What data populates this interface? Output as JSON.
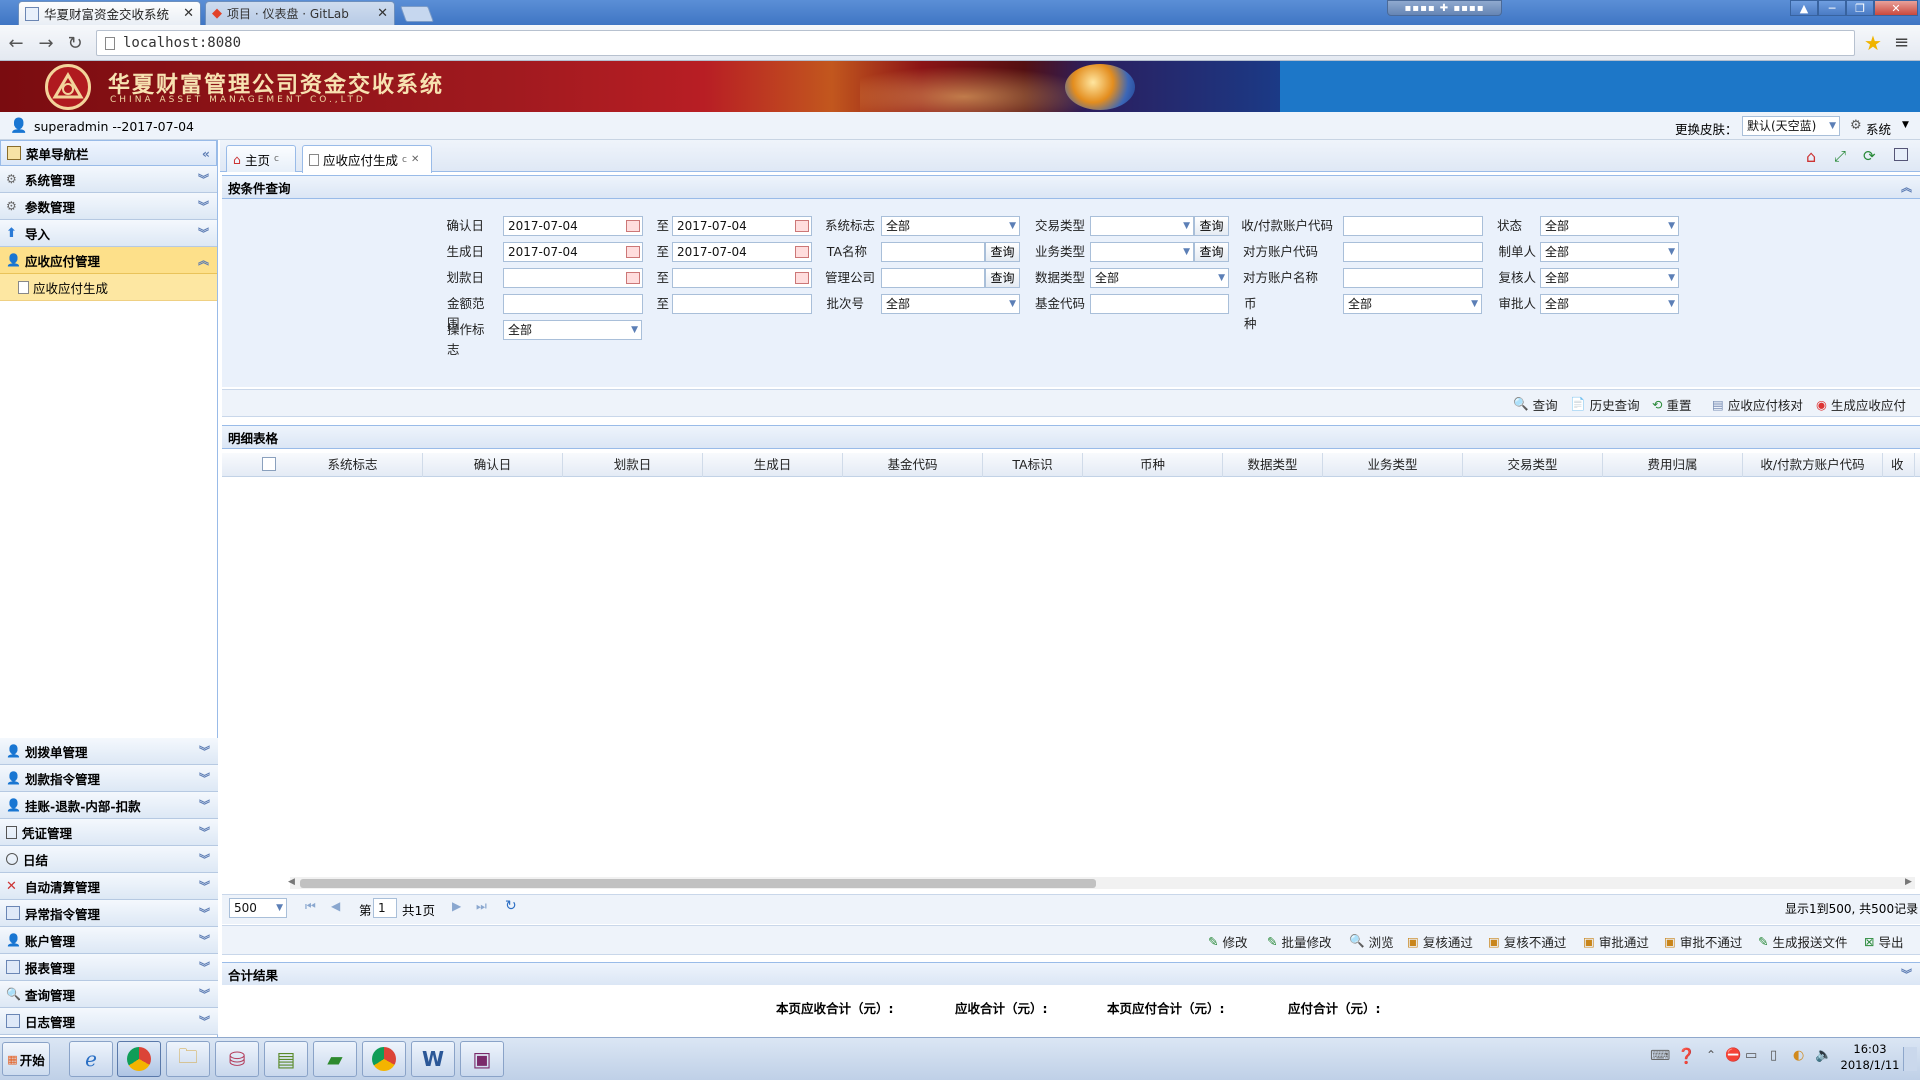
{
  "browser": {
    "tabs": [
      {
        "title": "华夏财富资金交收系统"
      },
      {
        "title": "项目 · 仪表盘 · GitLab"
      }
    ],
    "url": "localhost:8080"
  },
  "banner": {
    "title": "华夏财富管理公司资金交收系统",
    "subtitle": "CHINA ASSET MANAGEMENT CO.,LTD"
  },
  "userbar": {
    "user": "superadmin --2017-07-04",
    "skin_label": "更换皮肤：",
    "skin_value": "默认(天空蓝)",
    "system_label": "系统"
  },
  "sidebar": {
    "header": "菜单导航栏",
    "top_items": [
      {
        "label": "系统管理"
      },
      {
        "label": "参数管理"
      },
      {
        "label": "导入"
      },
      {
        "label": "应收应付管理"
      }
    ],
    "sub_items": [
      {
        "label": "应收应付生成"
      }
    ],
    "bottom_items": [
      {
        "label": "划拨单管理"
      },
      {
        "label": "划款指令管理"
      },
      {
        "label": "挂账-退款-内部-扣款"
      },
      {
        "label": "凭证管理"
      },
      {
        "label": "日结"
      },
      {
        "label": "自动清算管理"
      },
      {
        "label": "异常指令管理"
      },
      {
        "label": "账户管理"
      },
      {
        "label": "报表管理"
      },
      {
        "label": "查询管理"
      },
      {
        "label": "日志管理"
      }
    ]
  },
  "content_tabs": [
    {
      "label": "主页"
    },
    {
      "label": "应收应付生成"
    }
  ],
  "query": {
    "title": "按条件查询",
    "to": "至",
    "query_btn": "查询",
    "fields": {
      "confirm_date": {
        "label": "确认日",
        "from": "2017-07-04",
        "to": "2017-07-04"
      },
      "gen_date": {
        "label": "生成日",
        "from": "2017-07-04",
        "to": "2017-07-04"
      },
      "pay_date": {
        "label": "划款日",
        "from": "",
        "to": ""
      },
      "amount_range": {
        "label": "金额范围",
        "from": "",
        "to": ""
      },
      "op_flag": {
        "label": "操作标志",
        "value": "全部"
      },
      "sys_flag": {
        "label": "系统标志",
        "value": "全部"
      },
      "ta_name": {
        "label": "TA名称",
        "value": ""
      },
      "mgmt_company": {
        "label": "管理公司",
        "value": ""
      },
      "batch_no": {
        "label": "批次号",
        "value": "全部"
      },
      "trade_type": {
        "label": "交易类型",
        "value": ""
      },
      "biz_type": {
        "label": "业务类型",
        "value": ""
      },
      "data_type": {
        "label": "数据类型",
        "value": "全部"
      },
      "fund_code": {
        "label": "基金代码",
        "value": ""
      },
      "acct_code": {
        "label": "收/付款账户代码",
        "value": ""
      },
      "counter_acct_code": {
        "label": "对方账户代码",
        "value": ""
      },
      "counter_acct_name": {
        "label": "对方账户名称",
        "value": ""
      },
      "currency": {
        "label": "币种",
        "value": "全部"
      },
      "status": {
        "label": "状态",
        "value": "全部"
      },
      "maker": {
        "label": "制单人",
        "value": "全部"
      },
      "reviewer": {
        "label": "复核人",
        "value": "全部"
      },
      "approver": {
        "label": "审批人",
        "value": "全部"
      }
    },
    "actions": [
      "查询",
      "历史查询",
      "重置",
      "应收应付核对",
      "生成应收应付"
    ]
  },
  "grid": {
    "title": "明细表格",
    "columns": [
      "系统标志",
      "确认日",
      "划款日",
      "生成日",
      "基金代码",
      "TA标识",
      "币种",
      "数据类型",
      "业务类型",
      "交易类型",
      "费用归属",
      "收/付款方账户代码",
      "收"
    ]
  },
  "pager": {
    "page_size": "500",
    "page_prefix": "第",
    "page_value": "1",
    "page_suffix": "共1页",
    "summary": "显示1到500, 共500记录"
  },
  "bottom_actions": [
    "修改",
    "批量修改",
    "浏览",
    "复核通过",
    "复核不通过",
    "审批通过",
    "审批不通过",
    "生成报送文件",
    "导出"
  ],
  "totals": {
    "title": "合计结果",
    "labels": [
      "本页应收合计（元）:",
      "应收合计（元）:",
      "本页应付合计（元）:",
      "应付合计（元）:"
    ]
  },
  "taskbar": {
    "start": "开始",
    "time": "16:03",
    "date": "2018/1/11"
  },
  "colors": {
    "panel_border": "#99bbe8",
    "active_menu": "#fde08a",
    "banner_blue": "#1d77c8"
  }
}
